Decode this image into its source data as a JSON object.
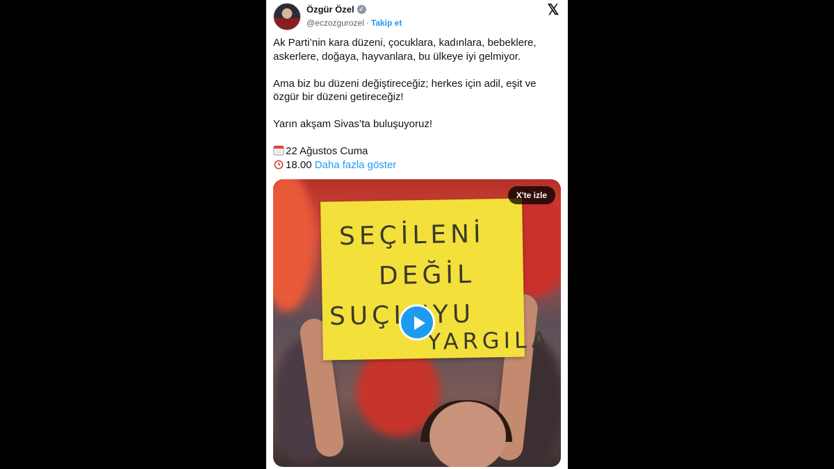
{
  "author": {
    "name": "Özgür Özel",
    "handle": "@eczozgurozel",
    "separator": "·",
    "follow_label": "Takip et"
  },
  "icons": {
    "verified": "verified-badge-icon",
    "x_logo": "x-logo-icon",
    "calendar": "calendar-emoji-icon",
    "clock": "alarm-clock-emoji-icon"
  },
  "tweet": {
    "para1": "Ak Parti’nin kara düzeni, çocuklara, kadınlara, bebeklere, askerlere, doğaya, hayvanlara, bu ülkeye iyi gelmiyor.",
    "para2": "Ama biz bu düzeni değiştireceğiz; herkes için adil, eşit ve özgür bir düzeni getireceğiz!",
    "para3": "Yarın akşam Sivas’ta buluşuyoruz!",
    "date": "22 Ağustos Cuma",
    "time": "18.00",
    "show_more": "Daha fazla göster"
  },
  "media": {
    "watch_label": "X'te izle",
    "sign_lines": [
      "SEÇİLENİ",
      "DEĞİL",
      "SUÇLUYU",
      "YARGILA"
    ]
  },
  "colors": {
    "accent": "#1d9bf0",
    "sign": "#f3e03b"
  }
}
